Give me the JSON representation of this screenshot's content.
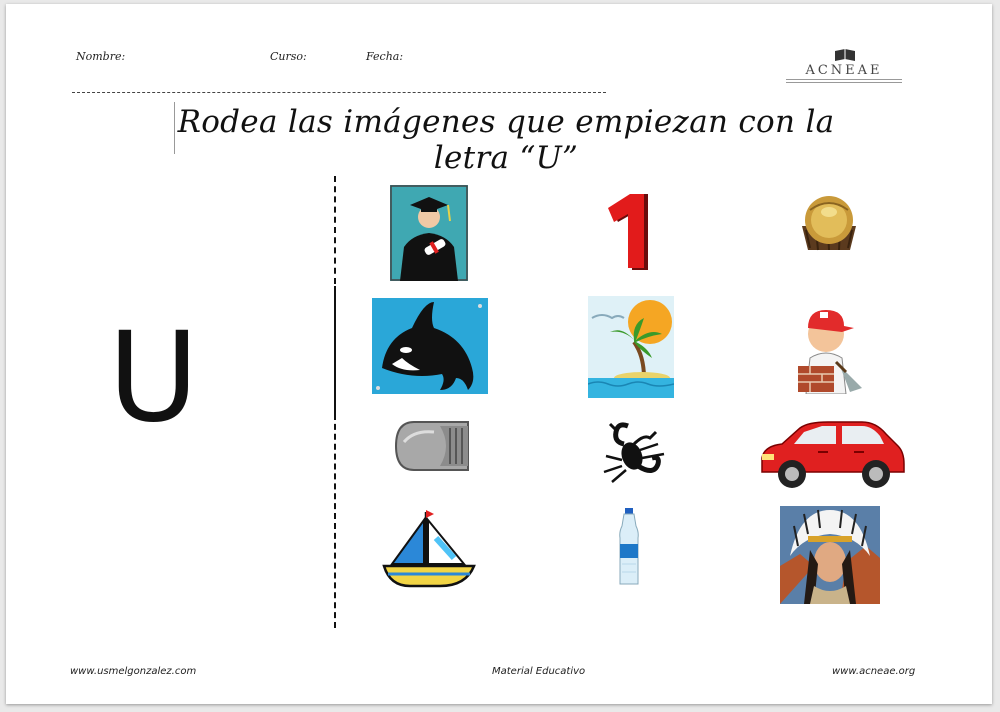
{
  "header": {
    "name_label": "Nombre:",
    "course_label": "Curso:",
    "date_label": "Fecha:"
  },
  "logo": {
    "text": "ACNEAE"
  },
  "title": "Rodea las imágenes que empiezan con la letra “U”",
  "letter": "U",
  "pictures": [
    {
      "row": 1,
      "col": 1,
      "icon": "graduate-icon"
    },
    {
      "row": 1,
      "col": 2,
      "icon": "number-one-icon"
    },
    {
      "row": 1,
      "col": 3,
      "icon": "chocolate-bonbon-icon"
    },
    {
      "row": 2,
      "col": 1,
      "icon": "orca-icon"
    },
    {
      "row": 2,
      "col": 2,
      "icon": "island-icon"
    },
    {
      "row": 2,
      "col": 3,
      "icon": "bricklayer-icon"
    },
    {
      "row": 3,
      "col": 1,
      "icon": "fingernail-icon"
    },
    {
      "row": 3,
      "col": 2,
      "icon": "scorpion-icon"
    },
    {
      "row": 3,
      "col": 3,
      "icon": "car-icon"
    },
    {
      "row": 4,
      "col": 1,
      "icon": "sailboat-icon"
    },
    {
      "row": 4,
      "col": 2,
      "icon": "water-bottle-icon"
    },
    {
      "row": 4,
      "col": 3,
      "icon": "native-headdress-icon"
    }
  ],
  "footer": {
    "left": "www.usmelgonzalez.com",
    "center": "Material Educativo",
    "right": "www.acneae.org"
  },
  "colors": {
    "accent_red": "#e02020",
    "sea_blue": "#2aa7d8",
    "sky_teal": "#3fa8b2"
  }
}
